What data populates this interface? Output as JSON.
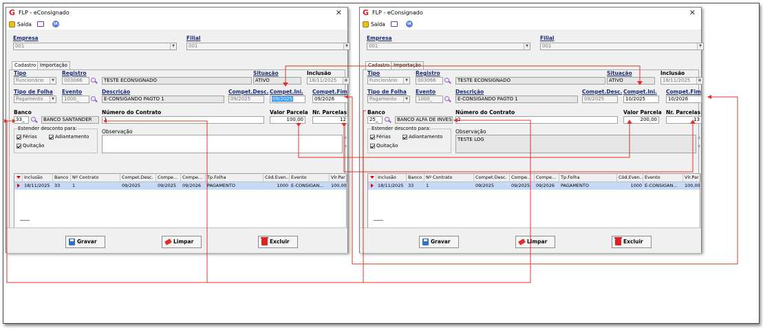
{
  "windows": [
    {
      "title": "FLP - eConsignado",
      "saida": "Saída",
      "ia": "IA",
      "empresa_label": "Empresa",
      "empresa_value": "001",
      "filial_label": "Filial",
      "filial_value": "001",
      "tabs": [
        "Cadastro",
        "Importação"
      ],
      "tipo_label": "Tipo",
      "tipo_value": "Funcionário",
      "registro_label": "Registro",
      "registro_value": "003066",
      "registro_nome": "TESTE ECONSIGNADO",
      "situacao_label": "Situação",
      "situacao_value": "ATIVO",
      "inclusao_label": "Inclusão",
      "inclusao_value": "18/11/2025",
      "tipofolha_label": "Tipo de Folha",
      "tipofolha_value": "Pagamento",
      "evento_label": "Evento",
      "evento_value": "1000_",
      "descricao_label": "Descrição",
      "descricao_value": "E-CONSIGANDO PAGTO 1",
      "competdesc_label": "Compet.Desc.",
      "competdesc_value": "09/2025",
      "competini_label": "Compet.Ini.",
      "competini_value": "09/2025",
      "competfim_label": "Compet.Fim",
      "competfim_value": "09/2026",
      "banco_label": "Banco",
      "banco_code": "33_",
      "banco_nome": "BANCO SANTANDER",
      "contrato_label": "Número do Contrato",
      "contrato_value": "1",
      "valorparcela_label": "Valor Parcela",
      "valorparcela_value": "100,00",
      "nrparcelas_label": "Nr. Parcelas",
      "nrparcelas_value": "12",
      "estender_label": "Estender desconto para:",
      "ferias": "Férias",
      "adiantamento": "Adiantamento",
      "quitacao": "Quitação",
      "observacao_label": "Observação",
      "observacao_value": "",
      "grid_headers": [
        "Inclusão",
        "Banco",
        "Nº Contrato",
        "Compet.Desc.",
        "Compe...",
        "Compe...",
        "Tp.Folha",
        "Cód.Even...",
        "Evento",
        "Vlr.Par"
      ],
      "grid_row": [
        "18/11/2025",
        "33",
        "1",
        "09/2025",
        "09/2025",
        "09/2026",
        "PAGAMENTO",
        "1000",
        "E-CONSIGAN...",
        "100,00"
      ],
      "btn_gravar": "Gravar",
      "btn_limpar": "Limpar",
      "btn_excluir": "Excluir"
    },
    {
      "title": "FLP - eConsignado",
      "saida": "Saída",
      "ia": "IA",
      "empresa_label": "Empresa",
      "empresa_value": "001",
      "filial_label": "Filial",
      "filial_value": "001",
      "tabs": [
        "Cadastro",
        "Importação"
      ],
      "tipo_label": "Tipo",
      "tipo_value": "Funcionário",
      "registro_label": "Registro",
      "registro_value": "003066",
      "registro_nome": "TESTE ECONSIGNADO",
      "situacao_label": "Situação",
      "situacao_value": "ATIVO",
      "inclusao_label": "Inclusão",
      "inclusao_value": "18/11/2025",
      "tipofolha_label": "Tipo de Folha",
      "tipofolha_value": "Pagamento",
      "evento_label": "Evento",
      "evento_value": "1000_",
      "descricao_label": "Descrição",
      "descricao_value": "E-CONSIGANDO PAGTO 1",
      "competdesc_label": "Compet.Desc.",
      "competdesc_value": "09/2025",
      "competini_label": "Compet.Ini.",
      "competini_value": "10/2025",
      "competfim_label": "Compet.Fim",
      "competfim_value": "10/2026",
      "banco_label": "Banco",
      "banco_code": "25_",
      "banco_nome": "BANCO ALFA DE INVES",
      "contrato_label": "Número do Contrato",
      "contrato_value": "2",
      "valorparcela_label": "Valor Parcela",
      "valorparcela_value": "200,00",
      "nrparcelas_label": "Nr. Parcelas",
      "nrparcelas_value": "13",
      "estender_label": "Estender desconto para:",
      "ferias": "Férias",
      "adiantamento": "Adiantamento",
      "quitacao": "Quitação",
      "observacao_label": "Observação",
      "observacao_value": "TESTE LOG",
      "grid_headers": [
        "Inclusão",
        "Banco",
        "Nº Contrato",
        "Compet.Desc.",
        "Compe...",
        "Compe...",
        "Tp.Folha",
        "Cód.Even...",
        "Evento",
        "Vlr.Par"
      ],
      "grid_row": [
        "18/11/2025",
        "33",
        "1",
        "09/2025",
        "09/2025",
        "09/2026",
        "PAGAMENTO",
        "1000",
        "E-CONSIGAN...",
        "100,00"
      ],
      "btn_gravar": "Gravar",
      "btn_limpar": "Limpar",
      "btn_excluir": "Excluir"
    }
  ],
  "colors": {
    "annotation": "#e0302a",
    "label": "#1a2a6e",
    "row_selected": "#c6d9f7",
    "highlight": "#3399ff"
  }
}
